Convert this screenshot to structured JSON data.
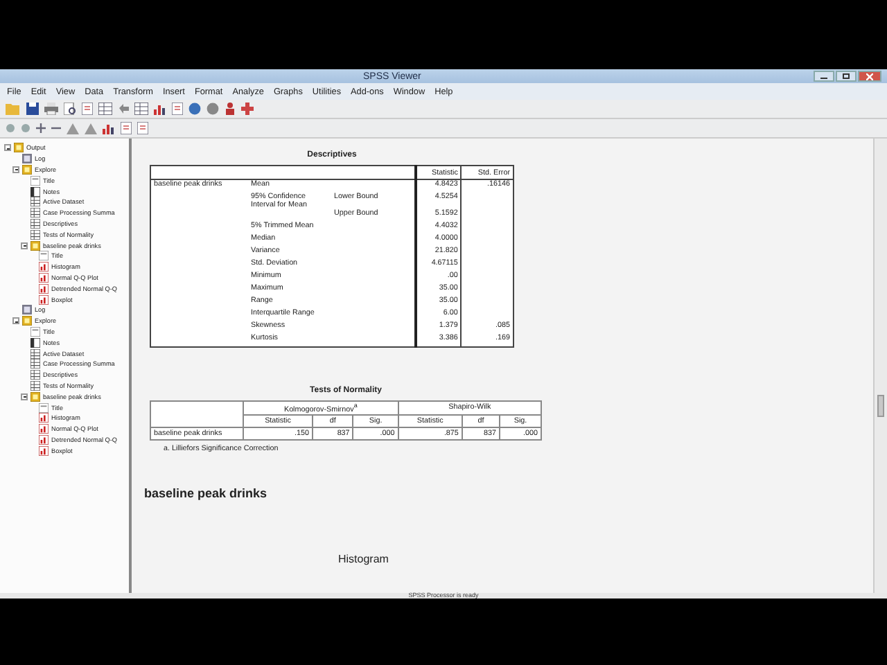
{
  "window": {
    "title": "SPSS Viewer"
  },
  "menu": [
    "File",
    "Edit",
    "View",
    "Data",
    "Transform",
    "Insert",
    "Format",
    "Analyze",
    "Graphs",
    "Utilities",
    "Add-ons",
    "Window",
    "Help"
  ],
  "tree": [
    {
      "label": "Output",
      "kind": "book",
      "expanded": true,
      "children": [
        {
          "label": "Log",
          "kind": "log"
        },
        {
          "label": "Explore",
          "kind": "book",
          "expanded": true,
          "children": [
            {
              "label": "Title",
              "kind": "title"
            },
            {
              "label": "Notes",
              "kind": "notes"
            },
            {
              "label": "Active Dataset",
              "kind": "table"
            },
            {
              "label": "Case Processing Summa",
              "kind": "table"
            },
            {
              "label": "Descriptives",
              "kind": "table"
            },
            {
              "label": "Tests of Normality",
              "kind": "table"
            },
            {
              "label": "baseline peak drinks",
              "kind": "book",
              "expanded": true,
              "children": [
                {
                  "label": "Title",
                  "kind": "title"
                },
                {
                  "label": "Histogram",
                  "kind": "chart"
                },
                {
                  "label": "Normal Q-Q Plot",
                  "kind": "chart"
                },
                {
                  "label": "Detrended Normal Q-Q",
                  "kind": "chart"
                },
                {
                  "label": "Boxplot",
                  "kind": "chart"
                }
              ]
            }
          ]
        },
        {
          "label": "Log",
          "kind": "log"
        },
        {
          "label": "Explore",
          "kind": "book",
          "expanded": true,
          "children": [
            {
              "label": "Title",
              "kind": "title"
            },
            {
              "label": "Notes",
              "kind": "notes"
            },
            {
              "label": "Active Dataset",
              "kind": "table"
            },
            {
              "label": "Case Processing Summa",
              "kind": "table"
            },
            {
              "label": "Descriptives",
              "kind": "table"
            },
            {
              "label": "Tests of Normality",
              "kind": "table"
            },
            {
              "label": "baseline peak drinks",
              "kind": "book",
              "expanded": true,
              "children": [
                {
                  "label": "Title",
                  "kind": "title"
                },
                {
                  "label": "Histogram",
                  "kind": "chart"
                },
                {
                  "label": "Normal Q-Q Plot",
                  "kind": "chart"
                },
                {
                  "label": "Detrended Normal Q-Q",
                  "kind": "chart"
                },
                {
                  "label": "Boxplot",
                  "kind": "chart"
                }
              ]
            }
          ]
        }
      ]
    }
  ],
  "descriptives": {
    "title": "Descriptives",
    "columns": [
      "Statistic",
      "Std. Error"
    ],
    "rows": [
      {
        "variable": "baseline peak drinks",
        "statistic_name": "Mean",
        "statistic": "4.8423",
        "std_error": ".16146"
      },
      {
        "statistic_name": "95% Confidence Interval for Mean",
        "bound": "Lower Bound",
        "statistic": "4.5254"
      },
      {
        "bound": "Upper Bound",
        "statistic": "5.1592"
      },
      {
        "statistic_name": "5% Trimmed Mean",
        "statistic": "4.4032"
      },
      {
        "statistic_name": "Median",
        "statistic": "4.0000"
      },
      {
        "statistic_name": "Variance",
        "statistic": "21.820"
      },
      {
        "statistic_name": "Std. Deviation",
        "statistic": "4.67115"
      },
      {
        "statistic_name": "Minimum",
        "statistic": ".00"
      },
      {
        "statistic_name": "Maximum",
        "statistic": "35.00"
      },
      {
        "statistic_name": "Range",
        "statistic": "35.00"
      },
      {
        "statistic_name": "Interquartile Range",
        "statistic": "6.00"
      },
      {
        "statistic_name": "Skewness",
        "statistic": "1.379",
        "std_error": ".085"
      },
      {
        "statistic_name": "Kurtosis",
        "statistic": "3.386",
        "std_error": ".169"
      }
    ]
  },
  "normality": {
    "title": "Tests of Normality",
    "groups": [
      "Kolmogorov-Smirnov$^{a}$",
      "Shapiro-Wilk"
    ],
    "columns": [
      "Statistic",
      "df",
      "Sig.",
      "Statistic",
      "df",
      "Sig."
    ],
    "rows": [
      {
        "variable": "baseline peak drinks",
        "values": [
          ".150",
          "837",
          ".000",
          ".875",
          "837",
          ".000"
        ]
      }
    ],
    "footnote": "a. Lilliefors Significance Correction"
  },
  "heading": "baseline peak drinks",
  "chart_title": "Histogram",
  "status_bar": "SPSS Processor is ready"
}
